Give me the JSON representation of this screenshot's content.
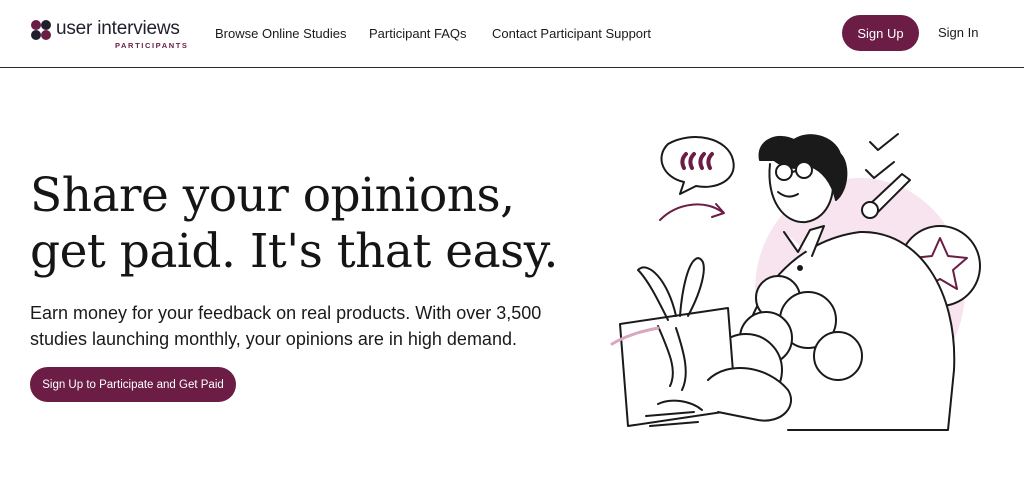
{
  "header": {
    "logo_text": "user interviews",
    "logo_subtext": "PARTICIPANTS",
    "nav": [
      {
        "label": "Browse Online Studies"
      },
      {
        "label": "Participant FAQs"
      },
      {
        "label": "Contact Participant Support"
      }
    ],
    "signup_label": "Sign Up",
    "signin_label": "Sign In"
  },
  "hero": {
    "headline_line1": "Share your opinions,",
    "headline_line2": "get paid. It's that easy.",
    "subtext": "Earn money for your feedback on real products. With over 3,500 studies launching monthly, your opinions are in high demand.",
    "cta_label": "Sign Up to Participate and Get Paid"
  },
  "colors": {
    "brand": "#6b1d45",
    "accent_pink": "#f7e4ee",
    "text": "#1a1a1a"
  },
  "icons": [
    "logo-mark-icon",
    "quote-bubble-icon",
    "checkmark-icon",
    "pencil-icon",
    "star-icon"
  ]
}
